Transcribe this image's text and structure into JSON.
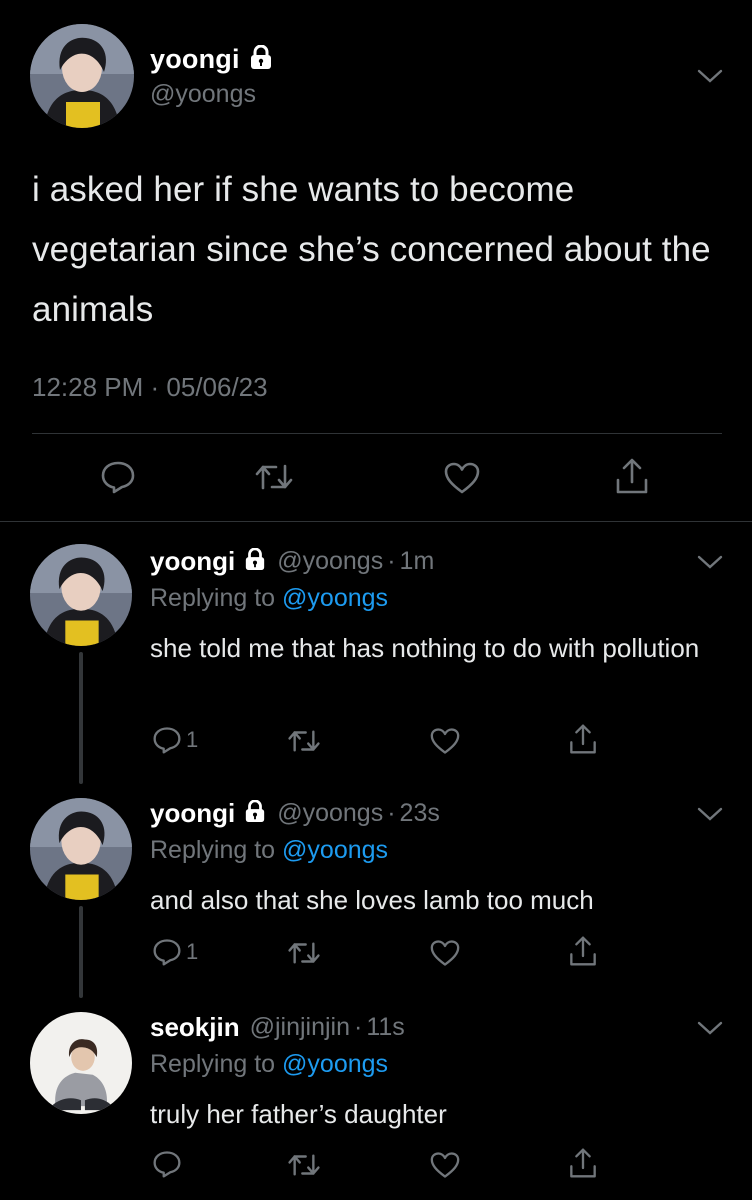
{
  "main": {
    "name": "yoongi",
    "handle": "@yoongs",
    "text": "i asked her if she wants to become vegetarian since she’s concerned about the animals",
    "timestamp": "12:28 PM · 05/06/23",
    "icons": {
      "lock": "lock-icon",
      "menu": "chevron-down-icon",
      "reply": "reply-icon",
      "retweet": "retweet-icon",
      "like": "heart-icon",
      "share": "share-icon"
    }
  },
  "replying_label": "Replying to",
  "replies": [
    {
      "name": "yoongi",
      "handle": "@yoongs",
      "dot": "·",
      "age": "1m",
      "replying_to": "@yoongs",
      "text": "she told me that has nothing to do with pollution",
      "reply_count": "1",
      "protected": true
    },
    {
      "name": "yoongi",
      "handle": "@yoongs",
      "dot": "·",
      "age": "23s",
      "replying_to": "@yoongs",
      "text": "and also that she loves lamb too much",
      "reply_count": "1",
      "protected": true
    },
    {
      "name": "seokjin",
      "handle": "@jinjinjin",
      "dot": "·",
      "age": "11s",
      "replying_to": "@yoongs",
      "text": "truly her father’s daughter",
      "reply_count": "",
      "protected": false
    }
  ],
  "colors": {
    "background": "#000000",
    "text": "#e7e9ea",
    "muted": "#71767b",
    "link": "#1d9bf0",
    "divider": "#2f3336"
  }
}
